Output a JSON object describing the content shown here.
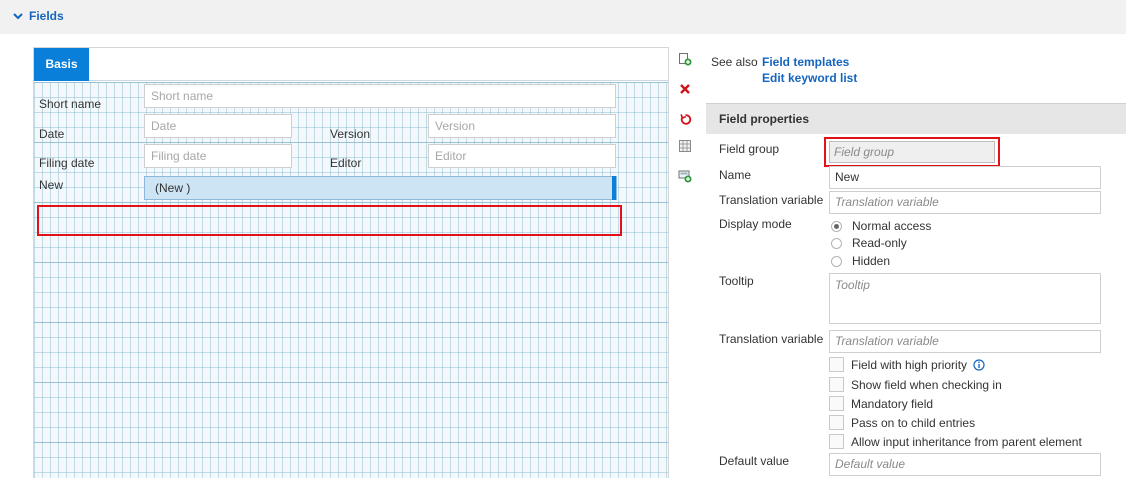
{
  "section": {
    "title": "Fields"
  },
  "designer": {
    "tab": "Basis",
    "fields": {
      "short_name": {
        "label": "Short name",
        "placeholder": "Short name"
      },
      "date": {
        "label": "Date",
        "placeholder": "Date"
      },
      "version": {
        "label": "Version",
        "placeholder": "Version"
      },
      "filing_date": {
        "label": "Filing date",
        "placeholder": "Filing date"
      },
      "editor": {
        "label": "Editor",
        "placeholder": "Editor"
      },
      "new": {
        "label": "New",
        "value": "(New )"
      }
    }
  },
  "toolbar": {
    "icons": [
      "add-field-icon",
      "delete-icon",
      "undo-icon",
      "grid-icon",
      "add-group-icon"
    ]
  },
  "see_also": {
    "label": "See also",
    "links": [
      "Field templates",
      "Edit keyword list"
    ]
  },
  "properties": {
    "title": "Field properties",
    "field_group": {
      "label": "Field group",
      "placeholder": "Field group"
    },
    "name": {
      "label": "Name",
      "value": "New"
    },
    "translation_variable": {
      "label": "Translation variable",
      "placeholder": "Translation variable"
    },
    "display_mode": {
      "label": "Display mode",
      "options": [
        "Normal access",
        "Read-only",
        "Hidden"
      ],
      "selected": "Normal access"
    },
    "tooltip": {
      "label": "Tooltip",
      "placeholder": "Tooltip"
    },
    "translation_variable_2": {
      "label": "Translation variable",
      "placeholder": "Translation variable"
    },
    "checkboxes": [
      "Field with high priority",
      "Show field when checking in",
      "Mandatory field",
      "Pass on to child entries",
      "Allow input inheritance from parent element"
    ],
    "default_value": {
      "label": "Default value",
      "placeholder": "Default value"
    }
  },
  "colors": {
    "accent": "#0a7fd9",
    "link": "#1565c0",
    "highlight": "#e3101a"
  }
}
